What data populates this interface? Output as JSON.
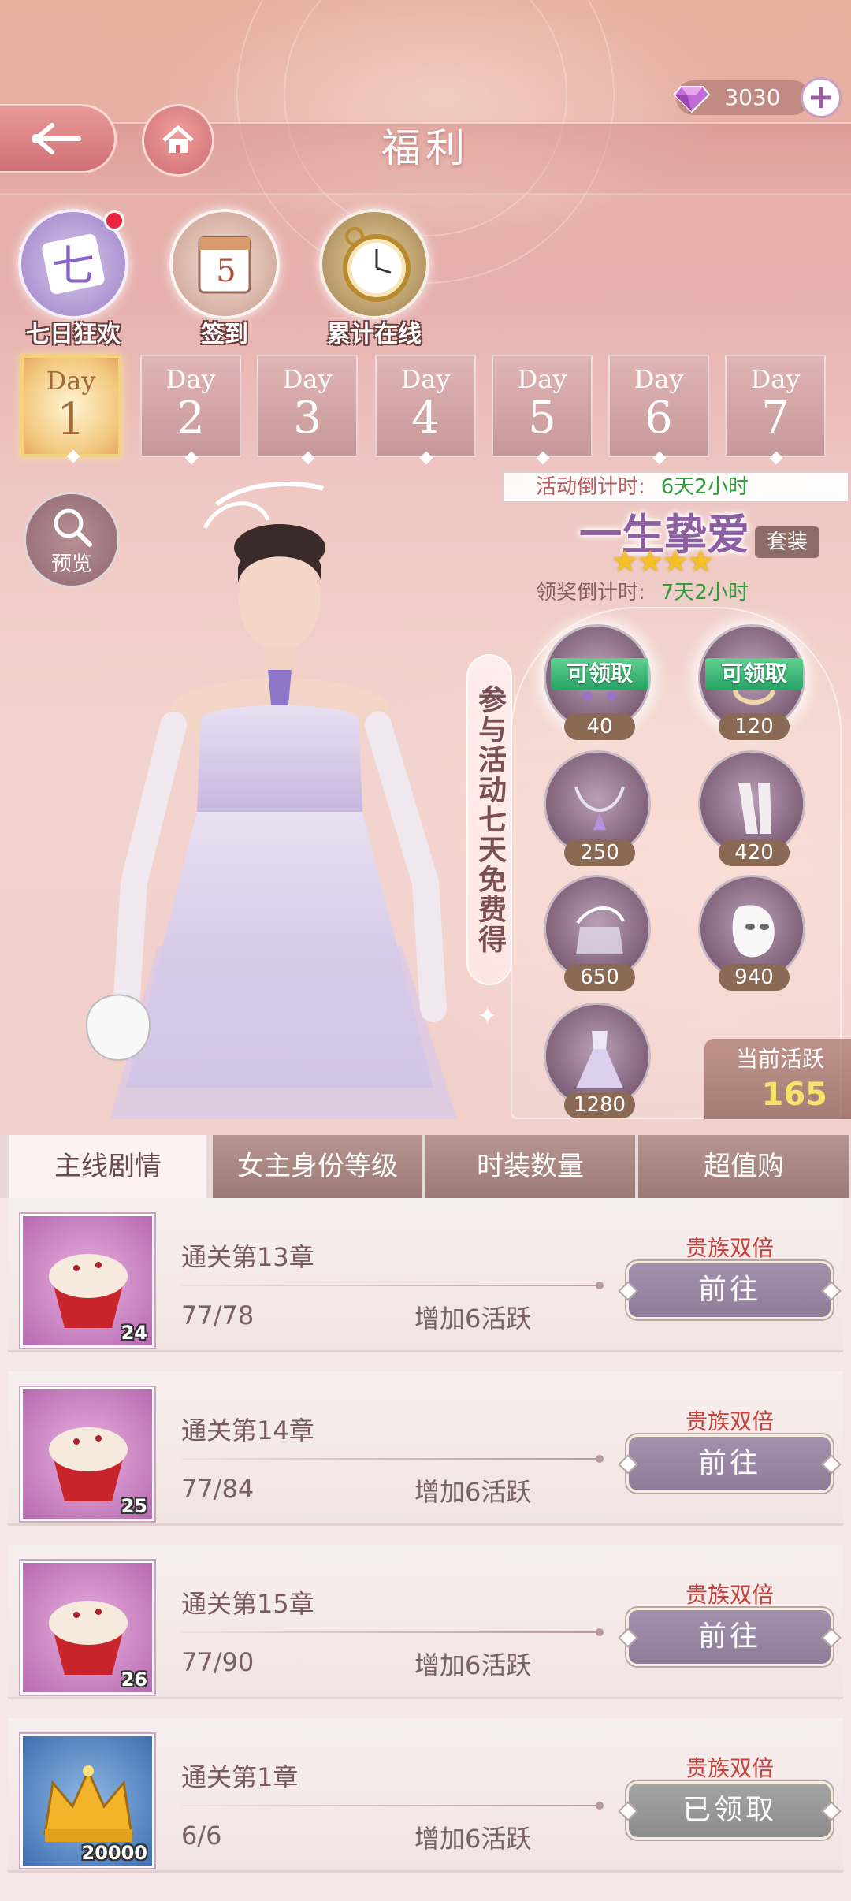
{
  "header": {
    "title": "福利",
    "gems": "3030"
  },
  "activities": [
    {
      "label": "七日狂欢",
      "badge_char": "七"
    },
    {
      "label": "签到",
      "calendar_number": "5"
    },
    {
      "label": "累计在线"
    }
  ],
  "days": [
    {
      "word": "Day",
      "num": "1"
    },
    {
      "word": "Day",
      "num": "2"
    },
    {
      "word": "Day",
      "num": "3"
    },
    {
      "word": "Day",
      "num": "4"
    },
    {
      "word": "Day",
      "num": "5"
    },
    {
      "word": "Day",
      "num": "6"
    },
    {
      "word": "Day",
      "num": "7"
    }
  ],
  "preview": {
    "label": "预览"
  },
  "banner": {
    "text": "参与活动七天免费得"
  },
  "event": {
    "countdown_label": "活动倒计时:",
    "countdown_value": "6天2小时",
    "set_name": "一生挚爱",
    "set_tag": "套装",
    "stars": "★★★★",
    "reward_countdown_label": "领奖倒计时:",
    "reward_countdown_value": "7天2小时"
  },
  "rewards": [
    {
      "value": "40",
      "status": "可领取",
      "icon": "earring-icon"
    },
    {
      "value": "120",
      "status": "可领取",
      "icon": "bracelet-icon"
    },
    {
      "value": "250",
      "icon": "necklace-icon"
    },
    {
      "value": "420",
      "icon": "gloves-icon"
    },
    {
      "value": "650",
      "icon": "hair-veil-icon"
    },
    {
      "value": "940",
      "icon": "mask-icon"
    },
    {
      "value": "1280",
      "icon": "dress-icon"
    }
  ],
  "current_activity": {
    "label": "当前活跃",
    "value": "165"
  },
  "tabs": [
    "主线剧情",
    "女主身份等级",
    "时装数量",
    "超值购"
  ],
  "tasks": [
    {
      "title": "通关第13章",
      "progress": "77/78",
      "reward": "增加6活跃",
      "double": "贵族双倍",
      "button": "前往",
      "count": "24",
      "icon": "cupcake-icon"
    },
    {
      "title": "通关第14章",
      "progress": "77/84",
      "reward": "增加6活跃",
      "double": "贵族双倍",
      "button": "前往",
      "count": "25",
      "icon": "cupcake-icon"
    },
    {
      "title": "通关第15章",
      "progress": "77/90",
      "reward": "增加6活跃",
      "double": "贵族双倍",
      "button": "前往",
      "count": "26",
      "icon": "cupcake-icon"
    },
    {
      "title": "通关第1章",
      "progress": "6/6",
      "reward": "增加6活跃",
      "double": "贵族双倍",
      "button": "已领取",
      "count": "20000",
      "icon": "crown-icon"
    }
  ],
  "colors": {
    "accent_pink": "#cf6f74",
    "claim_green": "#29a466",
    "double_red": "#c9413c",
    "set_purple": "#8c5fa0",
    "active_yellow": "#f6e36a"
  }
}
